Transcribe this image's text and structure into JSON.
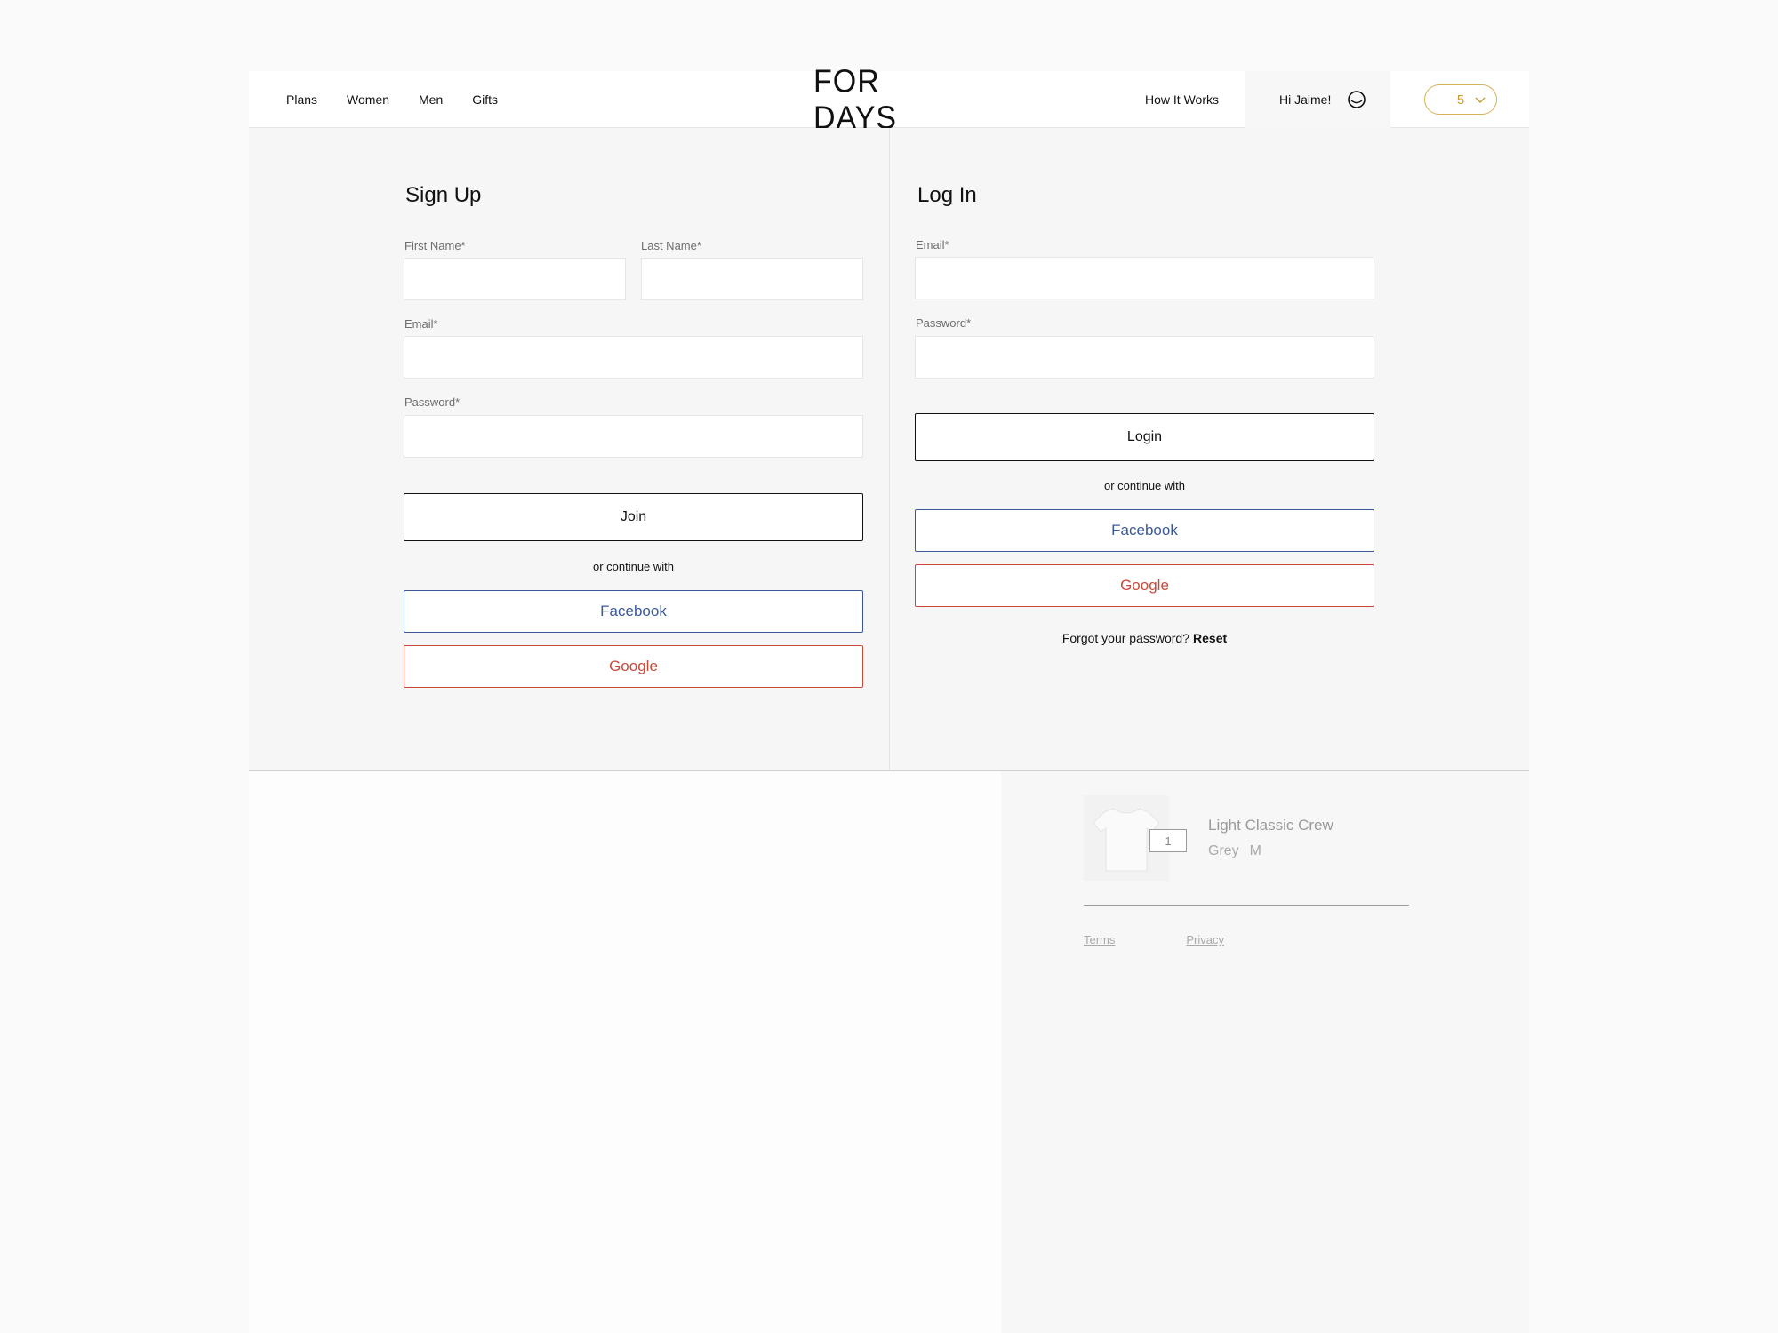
{
  "header": {
    "nav": [
      "Plans",
      "Women",
      "Men",
      "Gifts"
    ],
    "logo": "FOR DAYS",
    "how_it_works": "How It Works",
    "greeting": "Hi Jaime!",
    "cart_count": "5"
  },
  "signup": {
    "title": "Sign Up",
    "first_name_label": "First Name*",
    "last_name_label": "Last Name*",
    "email_label": "Email*",
    "password_label": "Password*",
    "join_label": "Join",
    "or_text": "or continue with",
    "facebook_label": "Facebook",
    "google_label": "Google"
  },
  "login": {
    "title": "Log In",
    "email_label": "Email*",
    "password_label": "Password*",
    "login_label": "Login",
    "or_text": "or continue with",
    "facebook_label": "Facebook",
    "google_label": "Google",
    "forgot_text": "Forgot your password?",
    "reset_label": "Reset"
  },
  "cart_item": {
    "name": "Light Classic Crew",
    "color": "Grey",
    "size": "M",
    "qty": "1"
  },
  "footer": {
    "terms": "Terms",
    "privacy": "Privacy"
  },
  "colors": {
    "facebook": "#3b5998",
    "google": "#c9493a",
    "accent": "#d6b25a"
  }
}
